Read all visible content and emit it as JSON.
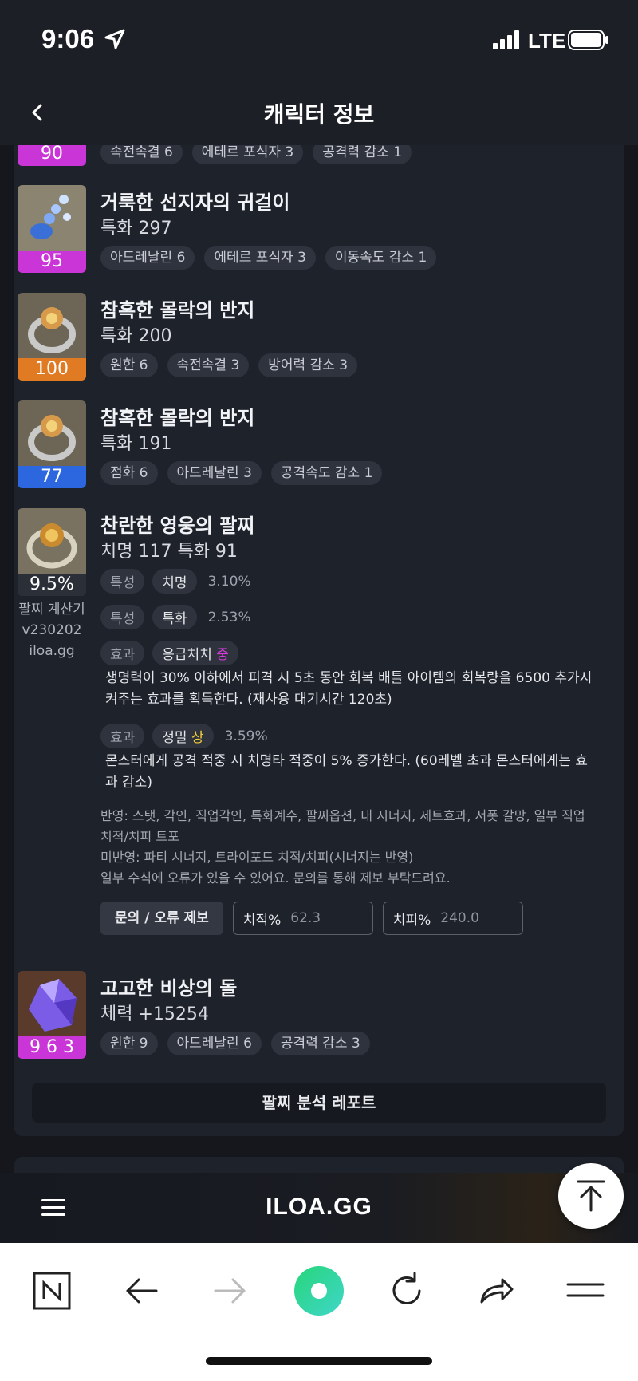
{
  "status_bar": {
    "time": "9:06",
    "network": "LTE"
  },
  "header": {
    "title": "캐릭터 정보"
  },
  "items": [
    {
      "level": "90",
      "chips": [
        "속전속결 6",
        "에테르 포식자 3",
        "공격력 감소 1"
      ]
    },
    {
      "name": "거룩한 선지자의 귀걸이",
      "stat": "특화 297",
      "level": "95",
      "chips": [
        "아드레날린 6",
        "에테르 포식자 3",
        "이동속도 감소 1"
      ]
    },
    {
      "name": "참혹한 몰락의 반지",
      "stat": "특화 200",
      "level": "100",
      "chips": [
        "원한 6",
        "속전속결 3",
        "방어력 감소 3"
      ]
    },
    {
      "name": "참혹한 몰락의 반지",
      "stat": "특화 191",
      "level": "77",
      "chips": [
        "점화 6",
        "아드레날린 3",
        "공격속도 감소 1"
      ]
    }
  ],
  "bracelet": {
    "name": "찬란한 영웅의 팔찌",
    "stat": "치명 117  특화 91",
    "level": "9.5%",
    "side_note": [
      "팔찌 계산기",
      "v230202",
      "iloa.gg"
    ],
    "attrs": [
      {
        "type": "특성",
        "value": "치명",
        "pct": "3.10%"
      },
      {
        "type": "특성",
        "value": "특화",
        "pct": "2.53%"
      }
    ],
    "effects": [
      {
        "type": "효과",
        "name": "응급처치",
        "grade": "중",
        "pct": "",
        "desc": "생명력이 30% 이하에서 피격 시 5초 동안 회복 배틀 아이템의 회복량을 6500 추가시켜주는 효과를 획득한다. (재사용 대기시간 120초)"
      },
      {
        "type": "효과",
        "name": "정밀",
        "grade": "상",
        "pct": "3.59%",
        "desc": "몬스터에게 공격 적중 시 치명타 적중이 5% 증가한다. (60레벨 초과 몬스터에게는 효과 감소)"
      }
    ],
    "notes": [
      "반영: 스탯, 각인, 직업각인, 특화계수, 팔찌옵션, 내 시너지, 세트효과, 서폿 갈망, 일부 직업 치적/치피 트포",
      "미반영: 파티 시너지, 트라이포드 치적/치피(시너지는 반영)",
      "일부 수식에 오류가 있을 수 있어요. 문의를 통해 제보 부탁드려요."
    ],
    "report_button": "문의 / 오류 제보",
    "crit_rate_label": "치적%",
    "crit_rate_value": "62.3",
    "crit_dmg_label": "치피%",
    "crit_dmg_value": "240.0"
  },
  "stone": {
    "name": "고고한 비상의 돌",
    "stat": "체력 +15254",
    "level": "9 6 3",
    "chips": [
      "원한 9",
      "아드레날린 6",
      "공격력 감소 3"
    ]
  },
  "analysis_button": "팔찌 분석 레포트",
  "bottom_nav": {
    "logo": "ILOA.GG"
  },
  "colors": {
    "purple": "#c935d6",
    "orange": "#e07b24",
    "blue": "#2d67e0",
    "grade_mid": "#d23dd8",
    "grade_high": "#f1cb3a"
  },
  "icons": [
    "location-arrow-icon",
    "signal-icon",
    "battery-icon",
    "back-icon",
    "menu-icon",
    "scroll-top-icon",
    "naver-icon",
    "browser-back-icon",
    "browser-forward-icon",
    "green-dot-icon",
    "refresh-icon",
    "share-icon",
    "browser-menu-icon"
  ]
}
